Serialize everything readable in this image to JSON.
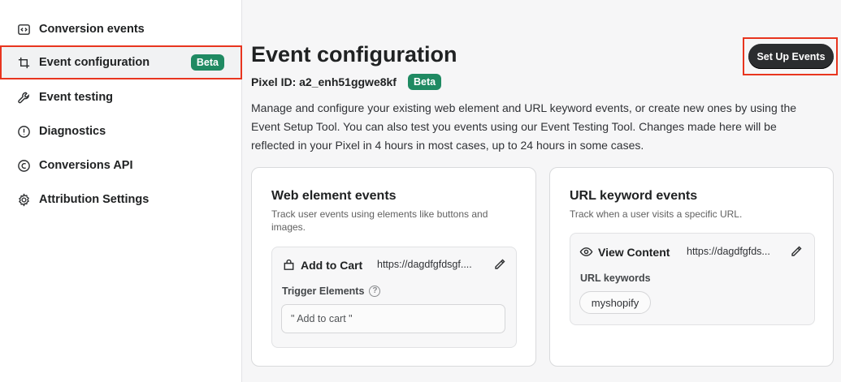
{
  "sidebar": {
    "items": [
      {
        "label": "Conversion events",
        "icon": "code-icon"
      },
      {
        "label": "Event configuration",
        "icon": "crop-icon",
        "badge": "Beta",
        "active": true
      },
      {
        "label": "Event testing",
        "icon": "wrench-icon"
      },
      {
        "label": "Diagnostics",
        "icon": "info-icon"
      },
      {
        "label": "Conversions API",
        "icon": "api-icon"
      },
      {
        "label": "Attribution Settings",
        "icon": "gear-icon"
      }
    ]
  },
  "header": {
    "title": "Event configuration",
    "pixel_id": "Pixel ID: a2_enh51ggwe8kf",
    "badge": "Beta",
    "setup_button": "Set Up Events",
    "description": "Manage and configure your existing web element and URL keyword events, or create new ones by using the Event Setup Tool. You can also test you events using our Event Testing Tool. Changes made here will be reflected in your Pixel in 4 hours in most cases, up to 24 hours in some cases."
  },
  "web_card": {
    "title": "Web element events",
    "subtitle": "Track user events using elements like buttons and images.",
    "event": {
      "name": "Add to Cart",
      "url": "https://dagdfgfdsgf....",
      "trigger_label": "Trigger Elements",
      "trigger_value": "\" Add to cart \""
    }
  },
  "url_card": {
    "title": "URL keyword events",
    "subtitle": "Track when a user visits a specific URL.",
    "event": {
      "name": "View Content",
      "url": "https://dagdfgfds...",
      "keywords_label": "URL keywords",
      "keywords": [
        "myshopify"
      ]
    }
  },
  "colors": {
    "accent_badge": "#1f8a62",
    "highlight_border": "#e8351f",
    "button_dark": "#2b2d2f"
  }
}
